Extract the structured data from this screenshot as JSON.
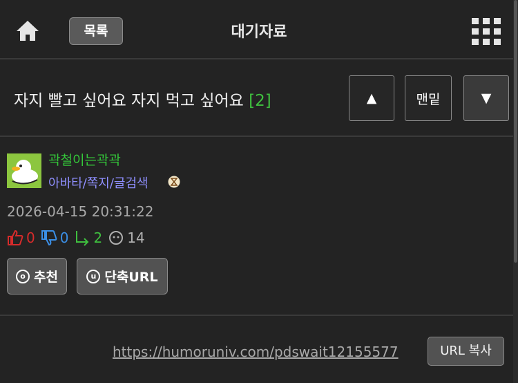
{
  "header": {
    "home_icon": "home-icon",
    "list_button": "목록",
    "title": "대기자료",
    "menu_icon": "grid-menu-icon"
  },
  "post": {
    "title": "자지 빨고 싶어요 자지 먹고 싶어요",
    "comment_count": "[2]",
    "nav": {
      "up_label": "▲",
      "bottom_label": "맨밑",
      "down_label": "▼"
    }
  },
  "author": {
    "avatar_icon": "duck-avatar-icon",
    "name": "곽철이는곽곽",
    "links": "아바타/쪽지/글검색",
    "badge_icon": "hourglass-icon"
  },
  "meta": {
    "date": "2026-04-15 20:31:22",
    "likes": "0",
    "dislikes": "0",
    "replies": "2",
    "views": "14"
  },
  "actions": {
    "recommend_icon_letter": "o",
    "recommend_label": "추천",
    "shorturl_icon_letter": "u",
    "shorturl_label": "단축URL"
  },
  "share": {
    "url": "https://humoruniv.com/pdswait12155577",
    "copy_label": "URL 복사"
  },
  "colors": {
    "background": "#232323",
    "green": "#3fbf3f",
    "blue_link": "#8f8fff",
    "red": "#d62b2b",
    "blue": "#3b8fe6"
  }
}
